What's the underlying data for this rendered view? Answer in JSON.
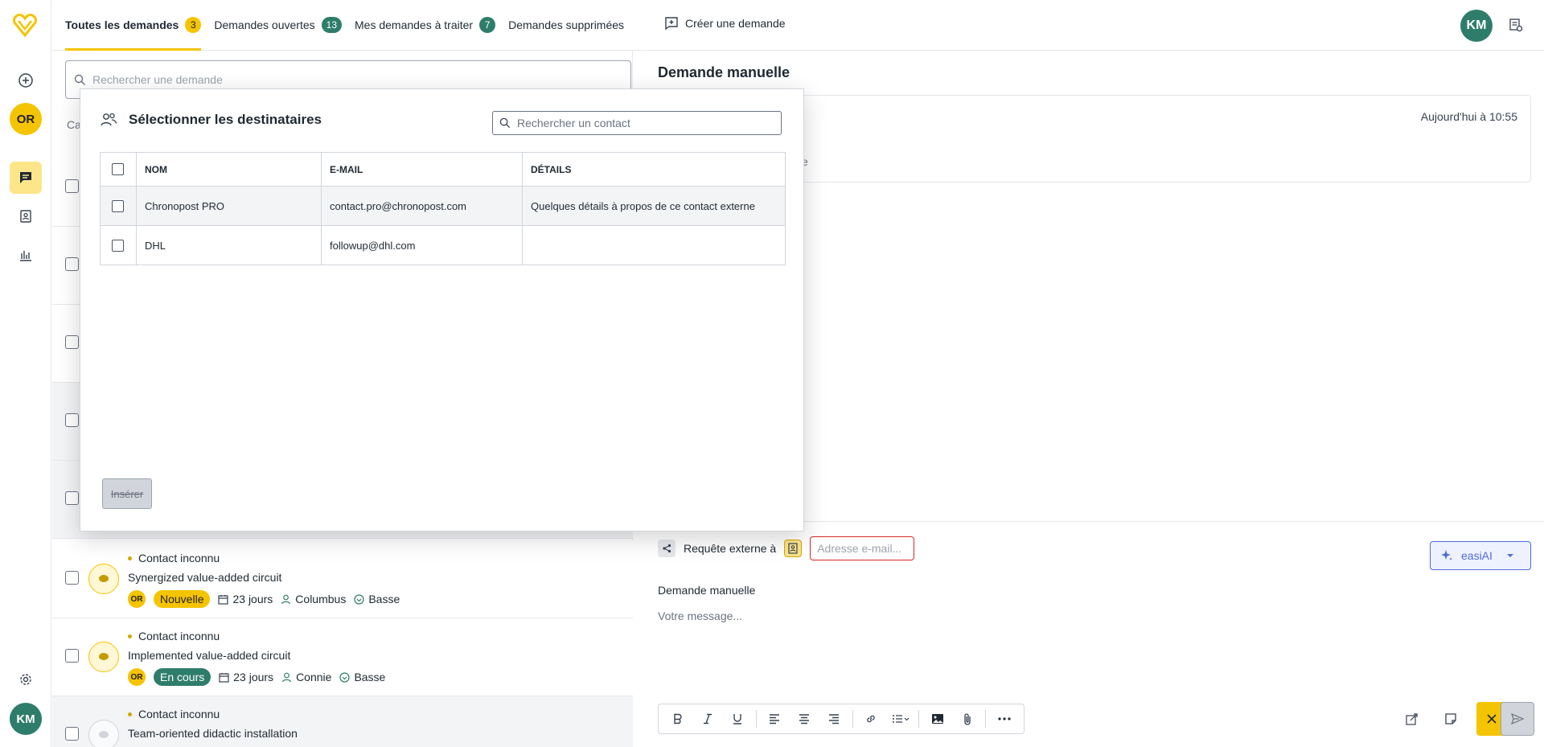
{
  "app": {
    "logo_icon": "heart-logo-icon",
    "brand_color": "#f5c400",
    "accent_teal": "#2e7d6b"
  },
  "rail": {
    "items": [
      {
        "icon": "plus-circle-icon"
      },
      {
        "avatar": "OR"
      },
      {
        "icon": "chat-icon",
        "active": true
      },
      {
        "icon": "contacts-icon"
      },
      {
        "icon": "chart-icon"
      }
    ],
    "bottom": {
      "settings_icon": "gear-icon",
      "avatar": "KM"
    }
  },
  "tabs": [
    {
      "label": "Toutes les demandes",
      "count": "3",
      "active": true
    },
    {
      "label": "Demandes ouvertes",
      "count": "13"
    },
    {
      "label": "Mes demandes à traiter",
      "count": "7"
    },
    {
      "label": "Demandes supprimées"
    }
  ],
  "list": {
    "search_placeholder": "Rechercher une demande",
    "category_partial": "Ca",
    "rows": [
      {
        "contact": "Contact inconnu",
        "title": "Synergized value-added circuit",
        "avatar": "OR",
        "status": "Nouvelle",
        "age": "23 jours",
        "assignee": "Columbus",
        "priority": "Basse"
      },
      {
        "contact": "Contact inconnu",
        "title": "Implemented value-added circuit",
        "avatar": "OR",
        "status": "En cours",
        "age": "23 jours",
        "assignee": "Connie",
        "priority": "Basse"
      },
      {
        "contact": "Contact inconnu",
        "title": "Team-oriented didactic installation"
      }
    ]
  },
  "detail": {
    "create_label": "Créer une demande",
    "user_avatar": "KM",
    "title": "Demande manuelle",
    "timestamp": "Aujourd'hui à 10:55",
    "trailing_text": "e"
  },
  "composer": {
    "external_label": "Requête externe à",
    "email_placeholder": "Adresse e-mail...",
    "ai_label": "easiAI",
    "subject": "Demande manuelle",
    "message_placeholder": "Votre message..."
  },
  "modal": {
    "title": "Sélectionner les destinataires",
    "search_placeholder": "Rechercher un contact",
    "columns": [
      "NOM",
      "E-MAIL",
      "DÉTAILS"
    ],
    "contacts": [
      {
        "name": "Chronopost PRO",
        "email": "contact.pro@chronopost.com",
        "details": "Quelques détails à propos de ce contact externe"
      },
      {
        "name": "DHL",
        "email": "followup@dhl.com",
        "details": ""
      }
    ],
    "insert_label": "Insérer"
  }
}
